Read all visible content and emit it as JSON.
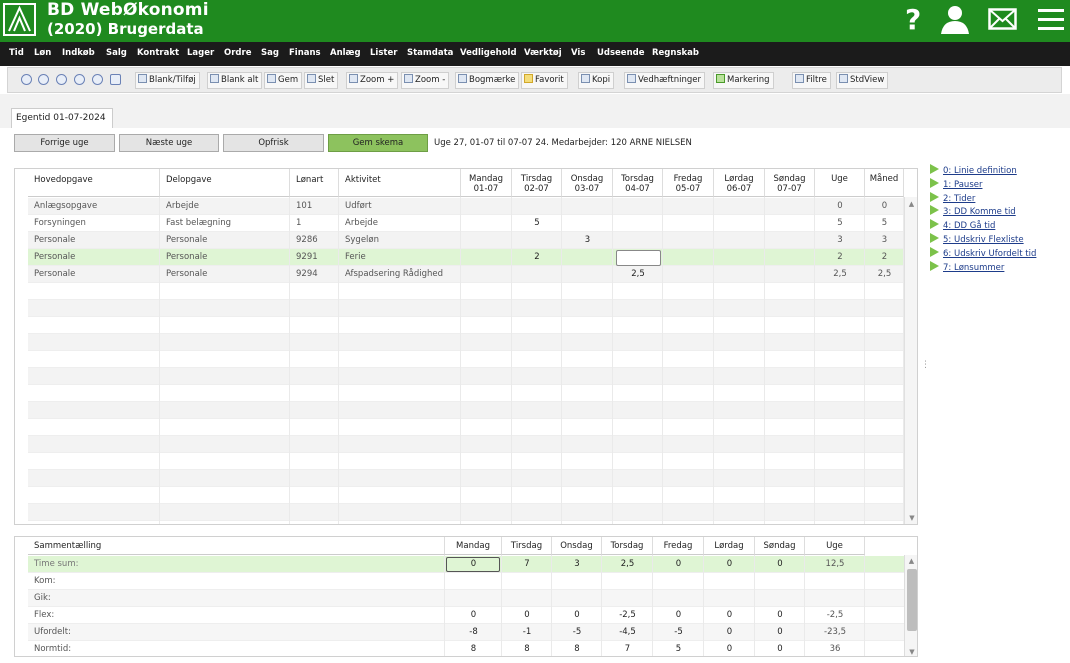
{
  "app": {
    "title": "BD WebØkonomi",
    "subtitle": "(2020) Brugerdata"
  },
  "header_icons": [
    "help-icon",
    "user-icon",
    "mail-icon",
    "menu-icon"
  ],
  "menu": [
    "Tid",
    "Løn",
    "Indkøb",
    "Salg",
    "Kontrakt",
    "Lager",
    "Ordre",
    "Sag",
    "Finans",
    "Anlæg",
    "Lister",
    "Stamdata",
    "Vedligehold",
    "Værktøj",
    "Vis",
    "Udseende",
    "Regnskab"
  ],
  "toolbar": {
    "blank_tilfoj": "Blank/Tilføj",
    "blank_alt": "Blank alt",
    "gem": "Gem",
    "slet": "Slet",
    "zoom_in": "Zoom +",
    "zoom_out": "Zoom -",
    "bogmaerke": "Bogmærke",
    "favorit": "Favorit",
    "kopi": "Kopi",
    "vedhaeftninger": "Vedhæftninger",
    "markering": "Markering",
    "filtre": "Filtre",
    "stdview": "StdView"
  },
  "tab": {
    "label": "Egentid 01-07-2024"
  },
  "buttons": {
    "prev": "Forrige uge",
    "next": "Næste uge",
    "refresh": "Opfrisk",
    "save": "Gem skema"
  },
  "week_info": "Uge 27, 01-07 til 07-07 24. Medarbejder: 120 ARNE NIELSEN",
  "grid": {
    "columns": [
      {
        "l1": "Hovedopgave",
        "l2": ""
      },
      {
        "l1": "Delopgave",
        "l2": ""
      },
      {
        "l1": "Lønart",
        "l2": ""
      },
      {
        "l1": "Aktivitet",
        "l2": ""
      },
      {
        "l1": "Mandag",
        "l2": "01-07"
      },
      {
        "l1": "Tirsdag",
        "l2": "02-07"
      },
      {
        "l1": "Onsdag",
        "l2": "03-07"
      },
      {
        "l1": "Torsdag",
        "l2": "04-07"
      },
      {
        "l1": "Fredag",
        "l2": "05-07"
      },
      {
        "l1": "Lørdag",
        "l2": "06-07"
      },
      {
        "l1": "Søndag",
        "l2": "07-07"
      },
      {
        "l1": "Uge",
        "l2": ""
      },
      {
        "l1": "Måned",
        "l2": ""
      }
    ],
    "rows": [
      [
        "Anlægsopgave",
        "Arbejde",
        "101",
        "Udført",
        "",
        "",
        "",
        "",
        "",
        "",
        "",
        "0",
        "0"
      ],
      [
        "Forsyningen",
        "Fast belægning",
        "1",
        "Arbejde",
        "",
        "5",
        "",
        "",
        "",
        "",
        "",
        "5",
        "5"
      ],
      [
        "Personale",
        "Personale",
        "9286",
        "Sygeløn",
        "",
        "",
        "3",
        "",
        "",
        "",
        "",
        "3",
        "3"
      ],
      [
        "Personale",
        "Personale",
        "9291",
        "Ferie",
        "",
        "2",
        "",
        "",
        "",
        "",
        "",
        "2",
        "2"
      ],
      [
        "Personale",
        "Personale",
        "9294",
        "Afspadsering Rådighed",
        "",
        "",
        "",
        "2,5",
        "",
        "",
        "",
        "2,5",
        "2,5"
      ]
    ]
  },
  "links": [
    "0: Linie definition",
    "1: Pauser",
    "2: Tider",
    "3: DD Komme tid",
    "4: DD Gå tid",
    "5: Udskriv Flexliste",
    "6: Udskriv Ufordelt tid",
    "7: Lønsummer"
  ],
  "summary": {
    "header": [
      "Sammentælling",
      "Mandag",
      "Tirsdag",
      "Onsdag",
      "Torsdag",
      "Fredag",
      "Lørdag",
      "Søndag",
      "Uge"
    ],
    "rows": [
      [
        "Time sum:",
        "0",
        "7",
        "3",
        "2,5",
        "0",
        "0",
        "0",
        "12,5"
      ],
      [
        "Kom:",
        "",
        "",
        "",
        "",
        "",
        "",
        "",
        ""
      ],
      [
        "Gik:",
        "",
        "",
        "",
        "",
        "",
        "",
        "",
        ""
      ],
      [
        "Flex:",
        "0",
        "0",
        "0",
        "-2,5",
        "0",
        "0",
        "0",
        "-2,5"
      ],
      [
        "Ufordelt:",
        "-8",
        "-1",
        "-5",
        "-4,5",
        "-5",
        "0",
        "0",
        "-23,5"
      ],
      [
        "Normtid:",
        "8",
        "8",
        "8",
        "7",
        "5",
        "0",
        "0",
        "36"
      ]
    ]
  }
}
